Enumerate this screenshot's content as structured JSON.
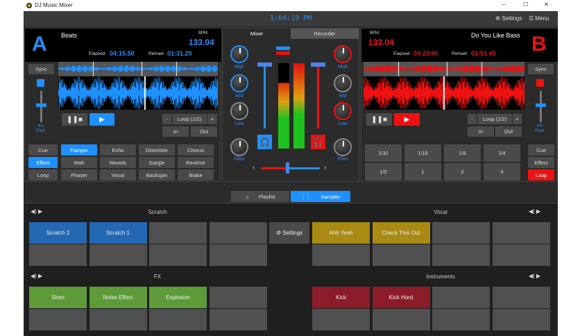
{
  "window": {
    "title": "DJ Music Mixer",
    "minimize": "–",
    "maximize": "☐",
    "close": "✕"
  },
  "toolbar": {
    "clock": "1:04:19 PM",
    "settings": "Settings",
    "menu": "Menu"
  },
  "deckA": {
    "letter": "A",
    "track": "Beats",
    "bpm_label": "BPM",
    "bpm": "133.04",
    "elapsed_label": "Elapsed",
    "elapsed": "04:15.50",
    "remain_label": "Remain",
    "remain": "01:31.20",
    "sync": "Sync",
    "pitch_value": "4%",
    "pitch_label": "Pitch",
    "loop_minus": "-",
    "loop": "Loop (1/2)",
    "loop_plus": "+",
    "in": "In",
    "out": "Out",
    "modes": [
      "Cue",
      "Effect",
      "Loop"
    ],
    "effects": [
      "Flanger",
      "Echo",
      "Distortion",
      "Chorus",
      "Wah",
      "Reverb",
      "Gargle",
      "Reverse",
      "Phaser",
      "Vocal",
      "Backspin",
      "Brake"
    ]
  },
  "deckB": {
    "letter": "B",
    "track": "Do You Like Bass",
    "bpm_label": "BPM",
    "bpm": "133.04",
    "elapsed_label": "Elapsed",
    "elapsed": "04:23.90",
    "remain_label": "Remain",
    "remain": "01:51.45",
    "sync": "Sync",
    "pitch_value": "0%",
    "pitch_label": "Pitch",
    "loop_minus": "-",
    "loop": "Loop (1/2)",
    "loop_plus": "+",
    "in": "In",
    "out": "Out",
    "modes": [
      "Cue",
      "Effect",
      "Loop"
    ],
    "loops": [
      "1/32",
      "1/16",
      "1/8",
      "1/4",
      "1/2",
      "1",
      "2",
      "4"
    ]
  },
  "mixer": {
    "tabs": [
      "Mixer",
      "Recorder"
    ],
    "high": "High",
    "mid": "Mid",
    "low": "Low",
    "filter": "Filter",
    "crossfader_position": 0.45
  },
  "bottom_tabs": [
    "Playlist",
    "Sampler"
  ],
  "sampler": {
    "settings": "Settings",
    "groups": [
      {
        "name": "Scratch",
        "color": "#2468b4",
        "pads": [
          "Scratch 2",
          "Scratch 1",
          "",
          "",
          "",
          "",
          "",
          ""
        ]
      },
      {
        "name": "Vocal",
        "color": "#a88a14",
        "pads": [
          "Ahh Yeah",
          "Check This Out",
          "",
          "",
          "",
          "",
          "",
          ""
        ]
      },
      {
        "name": "FX",
        "color": "#5f9a3a",
        "pads": [
          "Siren",
          "Noise Effect",
          "Explosion",
          "",
          "",
          "",
          "",
          ""
        ]
      },
      {
        "name": "Instruments",
        "color": "#8c1c2a",
        "pads": [
          "Kick",
          "Kick Hard",
          "",
          "",
          "",
          "",
          "",
          ""
        ]
      }
    ]
  },
  "colors": {
    "blue": "#1e90ff",
    "red": "#ee1111"
  }
}
